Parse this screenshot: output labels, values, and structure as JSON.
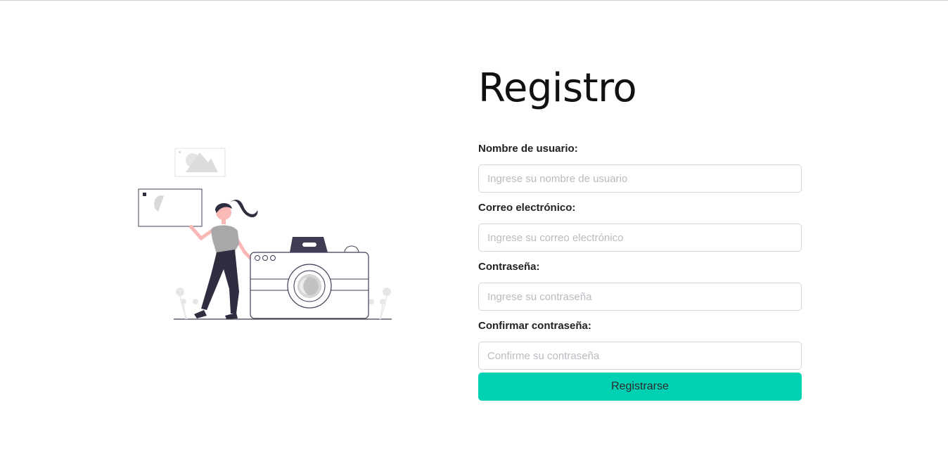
{
  "register": {
    "title": "Registro",
    "fields": {
      "username": {
        "label": "Nombre de usuario:",
        "placeholder": "Ingrese su nombre de usuario"
      },
      "email": {
        "label": "Correo electrónico:",
        "placeholder": "Ingrese su correo electrónico"
      },
      "password": {
        "label": "Contraseña:",
        "placeholder": "Ingrese su contraseña"
      },
      "confirm_password": {
        "label": "Confirmar contraseña:",
        "placeholder": "Confirme su contraseña"
      }
    },
    "submit_label": "Registrarse"
  },
  "illustration": {
    "icon": "woman-with-camera-illustration",
    "colors": {
      "dark": "#2f2e41",
      "skin": "#f9b7b5",
      "shirt": "#a8a8a8",
      "light": "#e6e6e6"
    }
  },
  "colors": {
    "accent": "#00d1b2",
    "input_border": "#d6d6d6",
    "placeholder": "#b7bcc1"
  }
}
